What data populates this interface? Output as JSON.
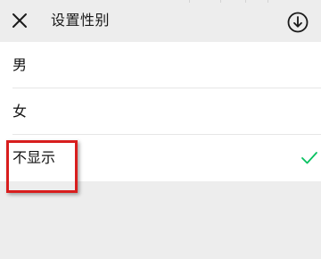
{
  "header": {
    "title": "设置性别",
    "close_icon": "close-icon",
    "download_icon": "download-circle-icon"
  },
  "options": [
    {
      "label": "男",
      "selected": false
    },
    {
      "label": "女",
      "selected": false
    },
    {
      "label": "不显示",
      "selected": true
    }
  ],
  "colors": {
    "background": "#ededed",
    "list_background": "#ffffff",
    "check_color": "#07c160",
    "annotation_color": "#d81e1e"
  },
  "annotation": {
    "type": "highlight-box",
    "target": "不显示"
  }
}
